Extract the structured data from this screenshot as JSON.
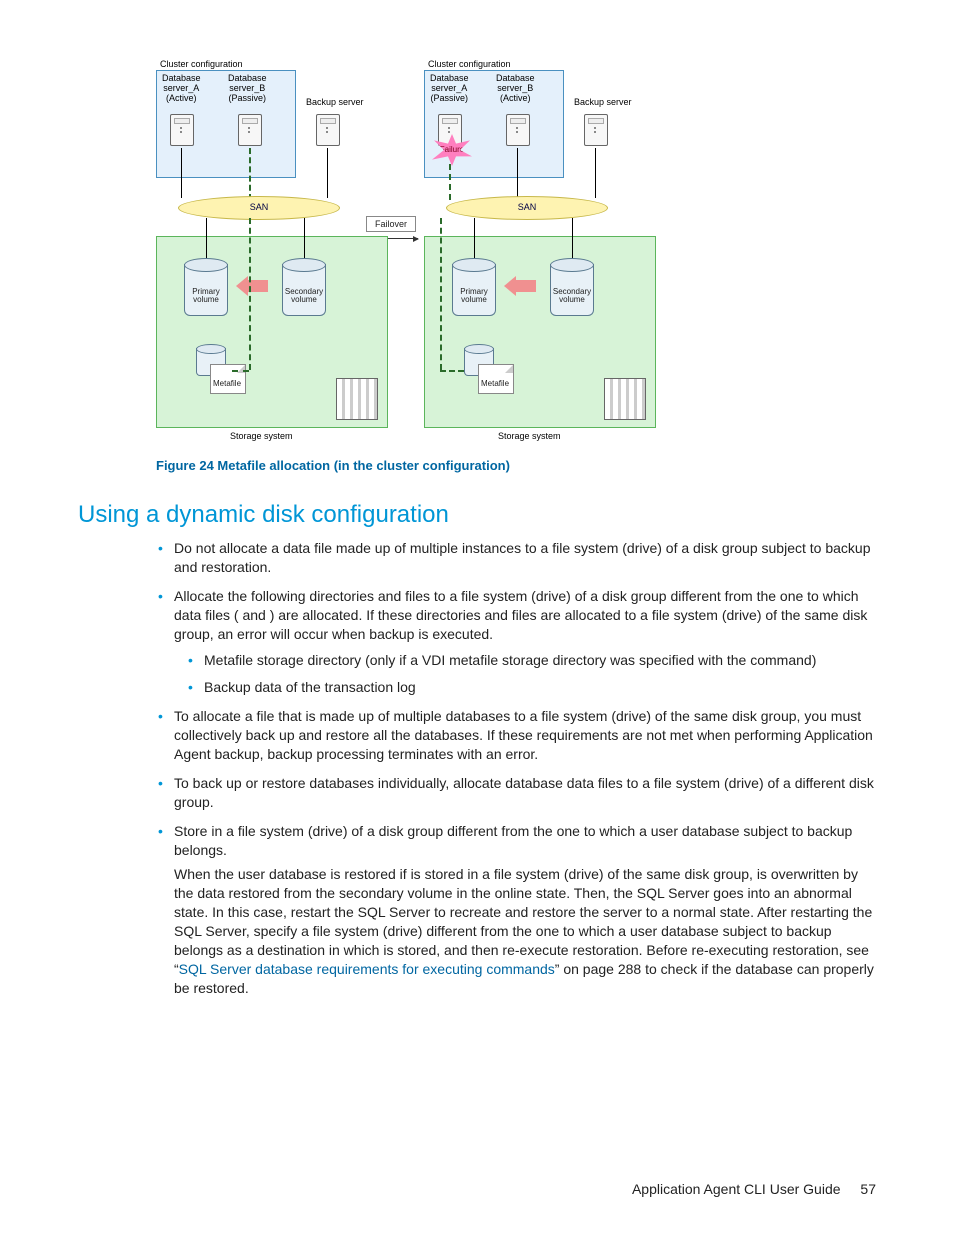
{
  "figure": {
    "caption": "Figure 24 Metafile allocation (in the cluster configuration)",
    "left": {
      "cluster_title": "Cluster configuration",
      "server_a": "Database\nserver_A\n(Active)",
      "server_b": "Database\nserver_B\n(Passive)",
      "backup": "Backup server",
      "san": "SAN",
      "primary": "Primary\nvolume",
      "secondary": "Secondary\nvolume",
      "metafile": "Metafile",
      "storage": "Storage system"
    },
    "right": {
      "cluster_title": "Cluster configuration",
      "server_a": "Database\nserver_A\n(Passive)",
      "server_b": "Database\nserver_B\n(Active)",
      "backup": "Backup server",
      "san": "SAN",
      "failure": "Failure",
      "primary": "Primary\nvolume",
      "secondary": "Secondary\nvolume",
      "metafile": "Metafile",
      "storage": "Storage system"
    },
    "failover": "Failover"
  },
  "heading": "Using a dynamic disk configuration",
  "bullets": {
    "b1": "Do not allocate a data file made up of multiple instances to a file system (drive) of a disk group subject to backup and restoration.",
    "b2": "Allocate the following directories and files to a file system (drive) of a disk group different from the one to which data files (             and             ) are allocated. If these directories and files are allocated to a file system (drive) of the same disk group, an error will occur when backup is executed.",
    "b2_s1": "Metafile storage directory (only if a VDI metafile storage directory was specified with the                      command)",
    "b2_s2": "Backup data of the transaction log",
    "b3": "To allocate a file that is made up of multiple databases to a file system (drive) of the same disk group, you must collectively back up and restore all the databases. If these requirements are not met when performing Application Agent backup, backup processing terminates with an error.",
    "b4": "To back up or restore databases individually, allocate database data files to a file system (drive) of a different disk group.",
    "b5_a": "Store              in a file system (drive) of a disk group different from the one to which a user database subject to backup belongs.",
    "b5_p1": "When the user database is restored if                is stored in a file system (drive) of the same disk group,              is overwritten by the data restored from the secondary volume in the online state. Then, the SQL Server goes into an abnormal state. In this case, restart the SQL Server to recreate              and restore the server to a normal state. After restarting the SQL Server, specify a file system (drive) different from the one to which a user database subject to backup belongs as a destination in which              is stored, and then re-execute restoration. Before re-executing restoration, see “",
    "b5_link": "SQL Server database requirements for executing commands",
    "b5_p2": "” on page 288 to check if the database can properly be restored."
  },
  "footer": {
    "title": "Application Agent CLI User Guide",
    "page": "57"
  }
}
